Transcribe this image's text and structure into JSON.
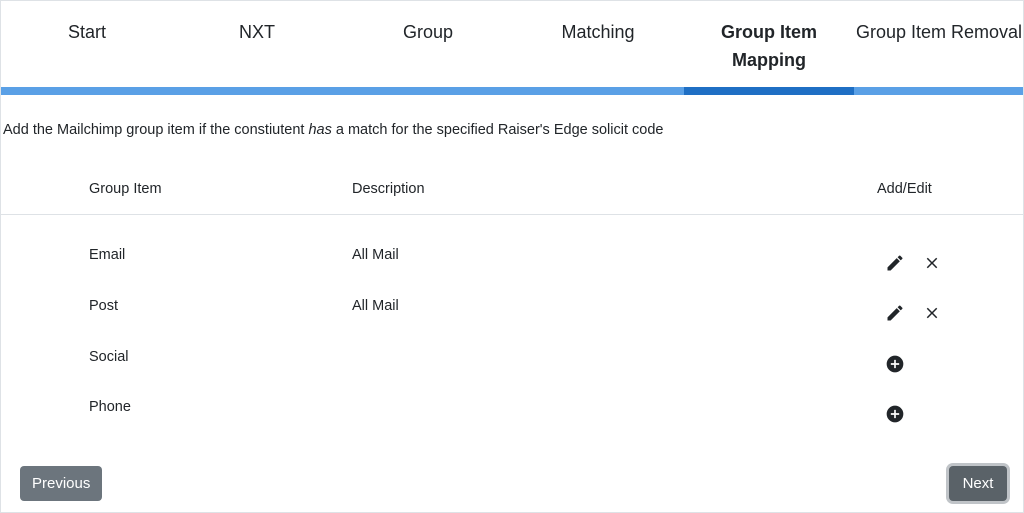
{
  "steps": [
    {
      "label": "Start",
      "active": false
    },
    {
      "label": "NXT",
      "active": false
    },
    {
      "label": "Group",
      "active": false
    },
    {
      "label": "Matching",
      "active": false
    },
    {
      "label": "Group Item Mapping",
      "active": true
    },
    {
      "label": "Group Item Removal",
      "active": false
    }
  ],
  "colors": {
    "step_bar": "#5aa0e6",
    "step_bar_active": "#1f6fc4",
    "button": "#6c757d"
  },
  "intro": {
    "before": "Add the Mailchimp group item if the constiutent ",
    "emphasis": "has",
    "after": " a match for the specified Raiser's Edge solicit code"
  },
  "table": {
    "headers": {
      "group_item": "Group Item",
      "description": "Description",
      "add_edit": "Add/Edit"
    },
    "rows": [
      {
        "group_item": "Email",
        "description": "All Mail",
        "actions": [
          "edit-icon",
          "delete-icon"
        ]
      },
      {
        "group_item": "Post",
        "description": "All Mail",
        "actions": [
          "edit-icon",
          "delete-icon"
        ]
      },
      {
        "group_item": "Social",
        "description": "",
        "actions": [
          "add-circle-icon"
        ]
      },
      {
        "group_item": "Phone",
        "description": "",
        "actions": [
          "add-circle-icon"
        ]
      }
    ]
  },
  "buttons": {
    "previous": "Previous",
    "next": "Next"
  }
}
